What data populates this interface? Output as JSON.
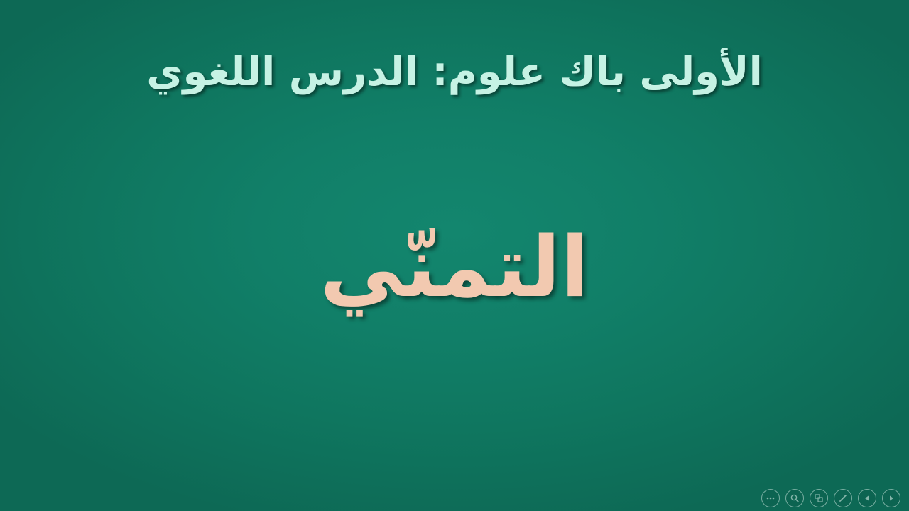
{
  "slide": {
    "title": "الأولى باك علوم: الدرس اللغوي",
    "main_text": "التمنّي"
  },
  "controls": [
    {
      "name": "more-options",
      "icon": "ellipsis-icon"
    },
    {
      "name": "zoom",
      "icon": "magnifier-icon"
    },
    {
      "name": "slide-overview",
      "icon": "slides-icon"
    },
    {
      "name": "pen",
      "icon": "pen-icon"
    },
    {
      "name": "previous-slide",
      "icon": "triangle-left-icon"
    },
    {
      "name": "next-slide",
      "icon": "triangle-right-icon"
    }
  ],
  "colors": {
    "background": "#117f68",
    "title": "#c6f2e4",
    "main_text": "#f2c9b0"
  }
}
